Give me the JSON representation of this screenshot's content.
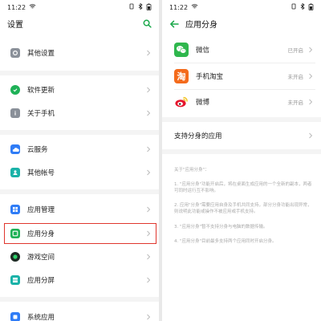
{
  "left": {
    "status_time": "11:22",
    "title": "设置",
    "items": [
      {
        "label": "其他设置"
      },
      {
        "label": "软件更新"
      },
      {
        "label": "关于手机"
      },
      {
        "label": "云服务"
      },
      {
        "label": "其他帐号"
      },
      {
        "label": "应用管理"
      },
      {
        "label": "应用分身"
      },
      {
        "label": "游戏空间"
      },
      {
        "label": "应用分屏"
      },
      {
        "label": "系统应用"
      }
    ]
  },
  "right": {
    "status_time": "11:22",
    "title": "应用分身",
    "apps": [
      {
        "name": "微信",
        "status": "已开启",
        "icon_glyph": ""
      },
      {
        "name": "手机淘宝",
        "status": "未开启",
        "icon_glyph": "淘"
      },
      {
        "name": "微博",
        "status": "未开启",
        "icon_glyph": ""
      }
    ],
    "supported_title": "支持分身的应用",
    "about_heading": "关于\"应用分身\"：",
    "about_notes": [
      "1. \"应用分身\"功能开启后，将在桌面生成应用的一个全新的副本，两者可同时运行互不影响。",
      "2. 应用\"分身\"需要应用自身及手机共同支持，部分分身功能出现异常，则说明此功能或操作不被应用或手机支持。",
      "3. \"应用分身\"暂不支持分身与电脑的数据传输。",
      "4. \"应用分身\"目前最多支持两个应用同时开启分身。"
    ]
  },
  "colors": {
    "accent": "#1aa84a",
    "highlight": "#e0362e",
    "wechat": "#2fb74d",
    "taobao": "#f46b1c",
    "weibo_red": "#e6162d",
    "weibo_yellow": "#f2c21b"
  }
}
